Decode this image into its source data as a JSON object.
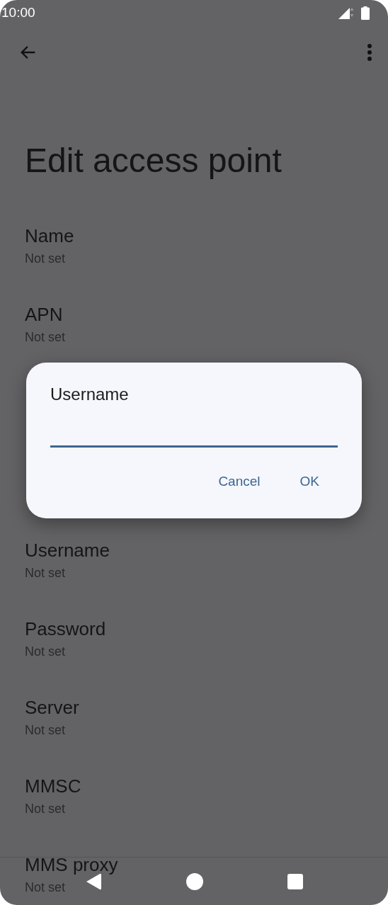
{
  "status_bar": {
    "time": "10:00"
  },
  "page_title": "Edit access point",
  "settings": [
    {
      "title": "Name",
      "summary": "Not set"
    },
    {
      "title": "APN",
      "summary": "Not set"
    },
    {
      "title": "Username",
      "summary": "Not set"
    },
    {
      "title": "Password",
      "summary": "Not set"
    },
    {
      "title": "Server",
      "summary": "Not set"
    },
    {
      "title": "MMSC",
      "summary": "Not set"
    },
    {
      "title": "MMS proxy",
      "summary": "Not set"
    }
  ],
  "dialog": {
    "title": "Username",
    "buttons": [
      "Cancel",
      "OK"
    ]
  }
}
